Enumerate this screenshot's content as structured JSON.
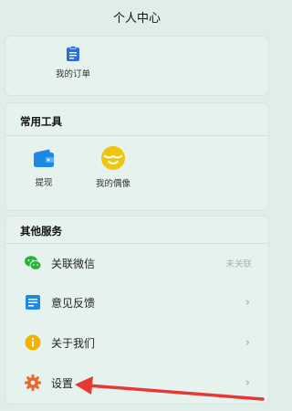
{
  "header": {
    "title": "个人中心"
  },
  "orders": {
    "label": "我的订单"
  },
  "tools": {
    "title": "常用工具",
    "items": [
      {
        "label": "提现",
        "icon": "wallet-icon"
      },
      {
        "label": "我的偶像",
        "icon": "idol-icon"
      }
    ]
  },
  "services": {
    "title": "其他服务",
    "items": [
      {
        "label": "关联微信",
        "status": "未关联",
        "icon": "wechat-icon"
      },
      {
        "label": "意见反馈",
        "icon": "feedback-icon"
      },
      {
        "label": "关于我们",
        "icon": "info-icon"
      },
      {
        "label": "设置",
        "icon": "gear-icon"
      }
    ]
  },
  "colors": {
    "background": "#dfeee9",
    "card": "#e6f2ee",
    "accent_blue": "#1e88e5",
    "wechat_green": "#2ab23a",
    "info_yellow": "#f0b400",
    "gear_orange": "#e8692c",
    "annotation_red": "#e53935"
  }
}
